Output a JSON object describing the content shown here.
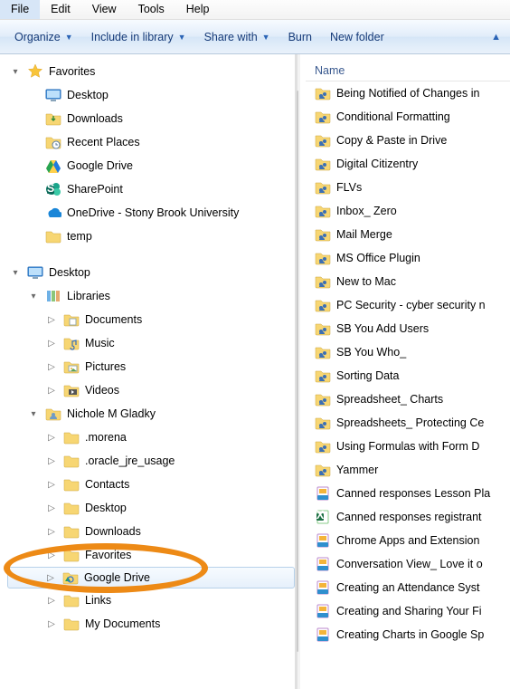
{
  "menu": [
    "File",
    "Edit",
    "View",
    "Tools",
    "Help"
  ],
  "toolbar": {
    "organize": "Organize",
    "include": "Include in library",
    "share": "Share with",
    "burn": "Burn",
    "newfolder": "New folder"
  },
  "tree": [
    {
      "i": 0,
      "t": "header",
      "label": "Favorites",
      "chev": "down",
      "icon": "star"
    },
    {
      "i": 1,
      "label": "Desktop",
      "icon": "desktop"
    },
    {
      "i": 1,
      "label": "Downloads",
      "icon": "dlfolder"
    },
    {
      "i": 1,
      "label": "Recent Places",
      "icon": "recent"
    },
    {
      "i": 1,
      "label": "Google Drive",
      "icon": "gdrive"
    },
    {
      "i": 1,
      "label": "SharePoint",
      "icon": "sharepoint"
    },
    {
      "i": 1,
      "label": "OneDrive - Stony Brook University",
      "icon": "onedrive"
    },
    {
      "i": 1,
      "label": "temp",
      "icon": "folder"
    },
    {
      "t": "gap"
    },
    {
      "i": 0,
      "t": "header",
      "label": "Desktop",
      "chev": "down",
      "icon": "desktop"
    },
    {
      "i": 1,
      "label": "Libraries",
      "chev": "down",
      "icon": "libraries"
    },
    {
      "i": 2,
      "label": "Documents",
      "chev": "right",
      "icon": "lib-doc"
    },
    {
      "i": 2,
      "label": "Music",
      "chev": "right",
      "icon": "lib-music"
    },
    {
      "i": 2,
      "label": "Pictures",
      "chev": "right",
      "icon": "lib-pic"
    },
    {
      "i": 2,
      "label": "Videos",
      "chev": "right",
      "icon": "lib-vid"
    },
    {
      "i": 1,
      "label": "Nichole M Gladky",
      "chev": "down",
      "icon": "userfolder"
    },
    {
      "i": 2,
      "label": ".morena",
      "chev": "right",
      "icon": "folder"
    },
    {
      "i": 2,
      "label": ".oracle_jre_usage",
      "chev": "right",
      "icon": "folder"
    },
    {
      "i": 2,
      "label": "Contacts",
      "chev": "right",
      "icon": "folder"
    },
    {
      "i": 2,
      "label": "Desktop",
      "chev": "right",
      "icon": "folder"
    },
    {
      "i": 2,
      "label": "Downloads",
      "chev": "right",
      "icon": "folder"
    },
    {
      "i": 2,
      "label": "Favorites",
      "chev": "right",
      "icon": "folder",
      "fade": true
    },
    {
      "i": 2,
      "label": "Google Drive",
      "chev": "right",
      "icon": "gfolder",
      "selected": true
    },
    {
      "i": 2,
      "label": "Links",
      "chev": "right",
      "icon": "folder",
      "fade": true
    },
    {
      "i": 2,
      "label": "My Documents",
      "chev": "right",
      "icon": "folder"
    }
  ],
  "column_header": "Name",
  "files": [
    {
      "k": "sharef",
      "label": "Being Notified of Changes in"
    },
    {
      "k": "sharef",
      "label": "Conditional Formatting"
    },
    {
      "k": "sharef",
      "label": "Copy & Paste in Drive"
    },
    {
      "k": "sharef",
      "label": "Digital Citizentry"
    },
    {
      "k": "sharef",
      "label": "FLVs"
    },
    {
      "k": "sharef",
      "label": "Inbox_ Zero"
    },
    {
      "k": "sharef",
      "label": "Mail Merge"
    },
    {
      "k": "sharef",
      "label": "MS Office Plugin"
    },
    {
      "k": "sharef",
      "label": "New to Mac"
    },
    {
      "k": "sharef",
      "label": "PC Security - cyber security n"
    },
    {
      "k": "sharef",
      "label": "SB You Add Users"
    },
    {
      "k": "sharef",
      "label": "SB You Who_"
    },
    {
      "k": "sharef",
      "label": "Sorting Data"
    },
    {
      "k": "sharef",
      "label": "Spreadsheet_ Charts"
    },
    {
      "k": "sharef",
      "label": "Spreadsheets_ Protecting Ce"
    },
    {
      "k": "sharef",
      "label": "Using Formulas with Form D"
    },
    {
      "k": "sharef",
      "label": "Yammer"
    },
    {
      "k": "gslide",
      "label": "Canned responses Lesson Pla"
    },
    {
      "k": "xlsx",
      "label": "Canned responses registrant"
    },
    {
      "k": "gslide",
      "label": "Chrome Apps and Extension"
    },
    {
      "k": "gslide",
      "label": "Conversation View_ Love it o"
    },
    {
      "k": "gslide",
      "label": "Creating an Attendance Syst"
    },
    {
      "k": "gslide",
      "label": "Creating and Sharing Your Fi"
    },
    {
      "k": "gslide",
      "label": "Creating Charts in Google Sp"
    }
  ]
}
